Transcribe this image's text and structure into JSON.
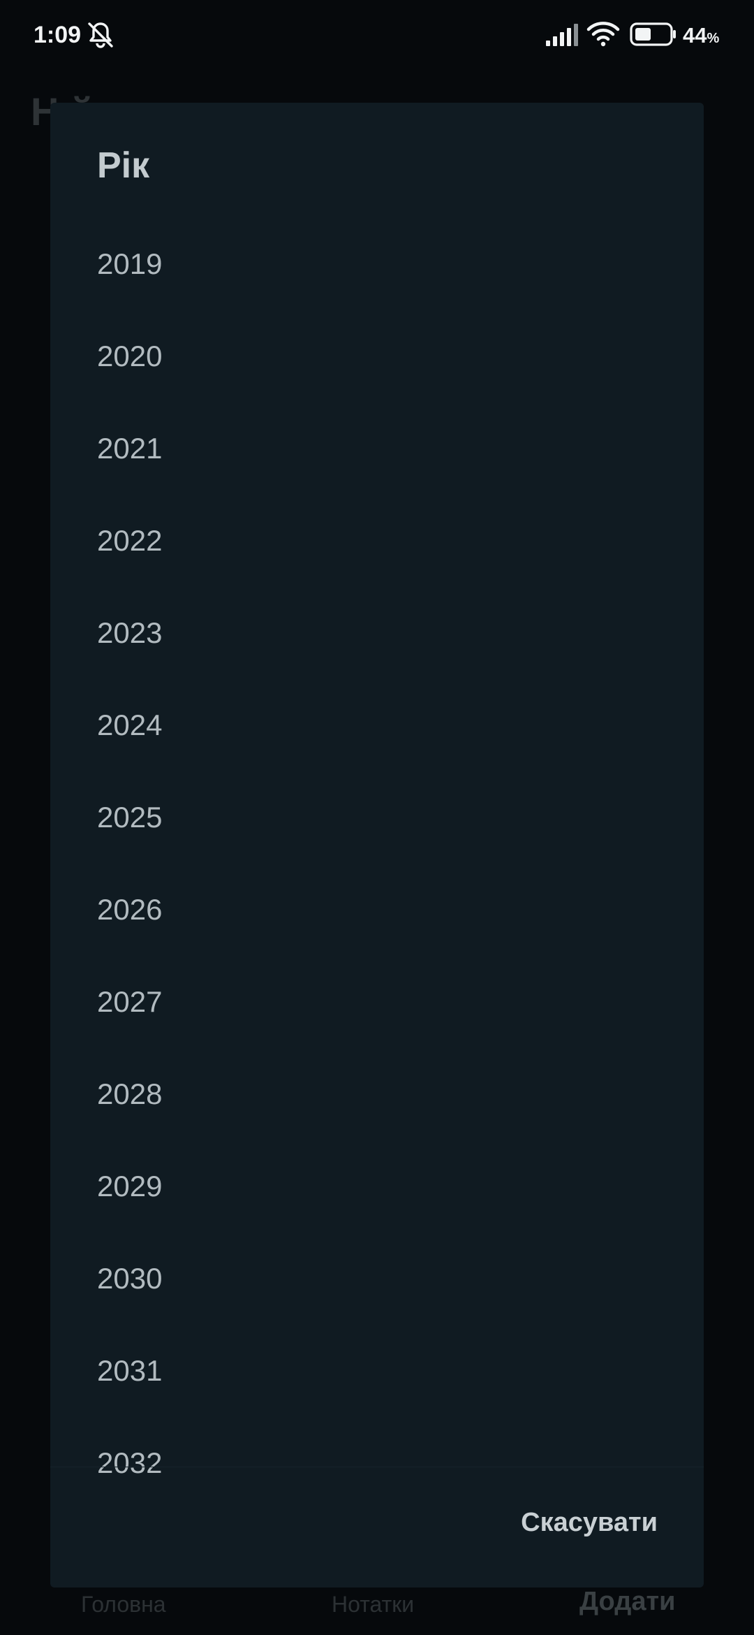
{
  "status_bar": {
    "time": "1:09",
    "battery_level": "44",
    "battery_unit": "%",
    "icons": [
      "bell-muted-icon",
      "signal-icon",
      "wifi-icon",
      "battery-icon"
    ]
  },
  "background": {
    "page_title": "Н    й",
    "nav": {
      "home": "Головна",
      "notes": "Нотатки",
      "add": "Додати"
    }
  },
  "dialog": {
    "title": "Рік",
    "years": [
      "2019",
      "2020",
      "2021",
      "2022",
      "2023",
      "2024",
      "2025",
      "2026",
      "2027",
      "2028",
      "2029",
      "2030",
      "2031",
      "2032"
    ],
    "cancel_label": "Скасувати"
  },
  "colors": {
    "dialog_background": "#101b22",
    "scrim": "#06090c",
    "year_text": "#b2bbc0",
    "title_text": "#c3cbcf"
  }
}
